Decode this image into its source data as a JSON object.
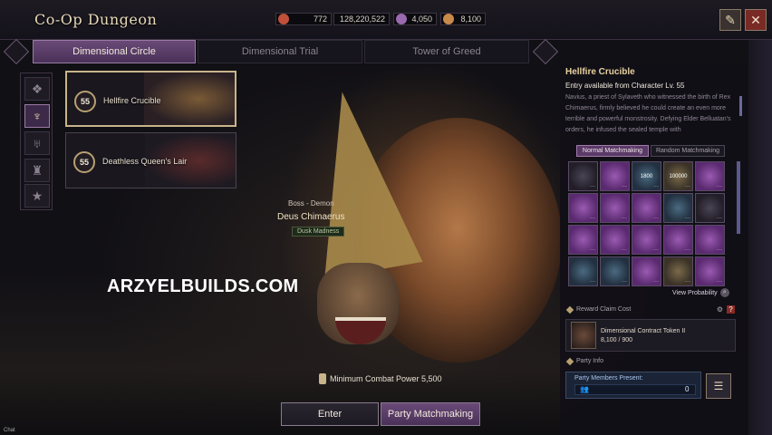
{
  "window": {
    "title": "Co-Op Dungeon",
    "help_icon": "book-icon",
    "close_icon": "close-icon"
  },
  "currencies": [
    {
      "icon": "ticket-icon",
      "value": "772",
      "color": "#c0503a"
    },
    {
      "icon": "silver-coin-icon",
      "value": "128,220,522",
      "color": "#c8b070"
    },
    {
      "icon": "crystal-icon",
      "value": "4,050",
      "color": "#9a6ab0"
    },
    {
      "icon": "gold-pouch-icon",
      "value": "8,100",
      "color": "#c88a4a"
    }
  ],
  "tabs": [
    {
      "label": "Dimensional Circle",
      "active": true
    },
    {
      "label": "Dimensional Trial",
      "active": false
    },
    {
      "label": "Tower of Greed",
      "active": false
    }
  ],
  "categories": [
    {
      "icon": "diamond-grid-icon",
      "active": false
    },
    {
      "icon": "demon-wings-icon",
      "active": true
    },
    {
      "icon": "horned-helm-icon",
      "active": false
    },
    {
      "icon": "knight-helm-icon",
      "active": false
    },
    {
      "icon": "star-icon",
      "active": false
    }
  ],
  "dungeons": [
    {
      "level": "55",
      "name": "Hellfire Crucible",
      "active": true
    },
    {
      "level": "55",
      "name": "Deathless Queen's Lair",
      "active": false
    }
  ],
  "boss": {
    "type": "Boss - Demon",
    "name": "Deus Chimaerus",
    "tag": "Dusk Madness"
  },
  "watermark": "ARZYELBUILDS.COM",
  "min_combat_power": "Minimum Combat Power 5,500",
  "buttons": {
    "enter": "Enter",
    "party": "Party Matchmaking"
  },
  "chat": "Chat",
  "detail": {
    "title": "Hellfire Crucible",
    "entry": "Entry available from Character Lv. 55",
    "description": "Navius, a priest of Sylaveth who witnessed the birth of Rex Chimaerus, firmly believed he could create an even more terrible and powerful monstrosity. Defying Elder Belluatan's orders, he infused the sealed temple with",
    "matchmaking_tabs": [
      {
        "label": "Normal Matchmaking",
        "active": true
      },
      {
        "label": "Random Matchmaking",
        "active": false
      }
    ],
    "rewards": [
      {
        "style": "dark",
        "label": ""
      },
      {
        "style": "purple",
        "label": ""
      },
      {
        "style": "blue",
        "label": "1800"
      },
      {
        "style": "gold",
        "label": "100000"
      },
      {
        "style": "purple",
        "label": ""
      },
      {
        "style": "purple",
        "label": ""
      },
      {
        "style": "purple",
        "label": ""
      },
      {
        "style": "purple",
        "label": ""
      },
      {
        "style": "blue",
        "label": ""
      },
      {
        "style": "dark",
        "label": ""
      },
      {
        "style": "purple",
        "label": ""
      },
      {
        "style": "purple",
        "label": ""
      },
      {
        "style": "purple",
        "label": ""
      },
      {
        "style": "purple",
        "label": ""
      },
      {
        "style": "purple",
        "label": ""
      },
      {
        "style": "blue",
        "label": ""
      },
      {
        "style": "blue",
        "label": ""
      },
      {
        "style": "purple",
        "label": ""
      },
      {
        "style": "gold",
        "label": ""
      },
      {
        "style": "purple",
        "label": ""
      }
    ],
    "view_probability": "View Probability",
    "reward_claim_cost": "Reward Claim Cost",
    "token_name": "Dimensional Contract Token II",
    "token_count": "8,100 / 900",
    "party_info": "Party Info",
    "party_members_label": "Party Members Present:",
    "party_members_count": "0"
  }
}
